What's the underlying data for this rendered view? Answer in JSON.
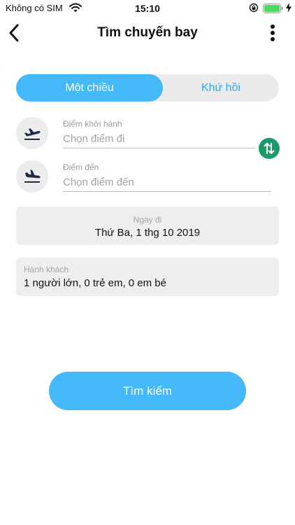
{
  "status_bar": {
    "carrier": "Không có SIM",
    "time": "15:10",
    "battery_color": "#4cd964"
  },
  "nav": {
    "title": "Tìm chuyến bay"
  },
  "trip_type": {
    "options": [
      {
        "label": "Một chiều",
        "selected": true
      },
      {
        "label": "Khứ hồi",
        "selected": false
      }
    ]
  },
  "departure": {
    "label": "Điểm khởi hành",
    "placeholder": "Chọn điểm đi",
    "icon": "takeoff-icon"
  },
  "arrival": {
    "label": "Điểm đến",
    "placeholder": "Chọn điểm đến",
    "icon": "landing-icon"
  },
  "swap": {
    "icon": "swap-arrows-icon",
    "color": "#1d9a6b"
  },
  "date": {
    "label": "Ngày đi",
    "value": "Thứ Ba, 1 thg 10 2019"
  },
  "passengers": {
    "label": "Hành khách",
    "value": "1 người lớn, 0 trẻ em, 0 em bé"
  },
  "search_button": {
    "label": "Tìm kiếm"
  },
  "colors": {
    "accent": "#45b8f9",
    "accent_text": "#2ea6ea"
  }
}
